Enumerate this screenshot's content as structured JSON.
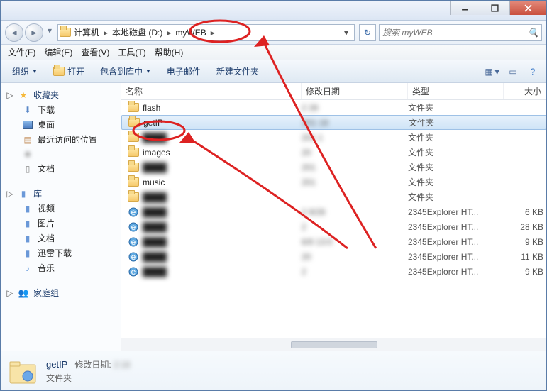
{
  "breadcrumb": {
    "parts": [
      "计算机",
      "本地磁盘 (D:)",
      "myWEB"
    ]
  },
  "search": {
    "placeholder": "搜索 myWEB"
  },
  "menus": [
    "文件(F)",
    "编辑(E)",
    "查看(V)",
    "工具(T)",
    "帮助(H)"
  ],
  "toolbar": {
    "organize": "组织",
    "open": "打开",
    "include": "包含到库中",
    "email": "电子邮件",
    "newfolder": "新建文件夹"
  },
  "sidebar": {
    "favorites": {
      "label": "收藏夹",
      "items": [
        "下载",
        "桌面",
        "最近访问的位置"
      ],
      "obscured": "        ",
      "doc": "文档"
    },
    "libraries": {
      "label": "库",
      "items": [
        "视频",
        "图片",
        "文档",
        "迅雷下载",
        "音乐"
      ]
    },
    "homegroup": {
      "label": "家庭组"
    }
  },
  "columns": {
    "name": "名称",
    "date": "修改日期",
    "type": "类型",
    "size": "大小"
  },
  "rows": [
    {
      "icon": "folder",
      "name": "flash",
      "date": "2          28",
      "type": "文件夹",
      "size": ""
    },
    {
      "icon": "folder",
      "name": "getIP",
      "date": "201        18",
      "type": "文件夹",
      "size": "",
      "selected": true
    },
    {
      "icon": "folder",
      "name": "",
      "name_blur": true,
      "date": "201        1",
      "type": "文件夹",
      "size": ""
    },
    {
      "icon": "folder",
      "name": "images",
      "date": "20",
      "type": "文件夹",
      "size": ""
    },
    {
      "icon": "folder",
      "name": "",
      "name_blur": true,
      "date": "201",
      "type": "文件夹",
      "size": ""
    },
    {
      "icon": "folder",
      "name": "music",
      "date": "201",
      "type": "文件夹",
      "size": ""
    },
    {
      "icon": "folder",
      "name": "",
      "name_blur": true,
      "date": "",
      "type": "文件夹",
      "size": ""
    },
    {
      "icon": "ie",
      "name": "",
      "name_blur": true,
      "date": "2       9/28",
      "type": "2345Explorer HT...",
      "size": "6 KB"
    },
    {
      "icon": "ie",
      "name": "",
      "name_blur": true,
      "date": "2",
      "type": "2345Explorer HT...",
      "size": "28 KB"
    },
    {
      "icon": "ie",
      "name": "",
      "name_blur": true,
      "date": "   6/9     13:0",
      "type": "2345Explorer HT...",
      "size": "9 KB"
    },
    {
      "icon": "ie",
      "name": "",
      "name_blur": true,
      "date": "20",
      "type": "2345Explorer HT...",
      "size": "11 KB"
    },
    {
      "icon": "ie",
      "name": "",
      "name_blur": true,
      "date": "2",
      "type": "2345Explorer HT...",
      "size": "9 KB"
    }
  ],
  "details": {
    "title": "getIP",
    "meta_label": "修改日期:",
    "meta_value": "             2:18",
    "type": "文件夹"
  }
}
